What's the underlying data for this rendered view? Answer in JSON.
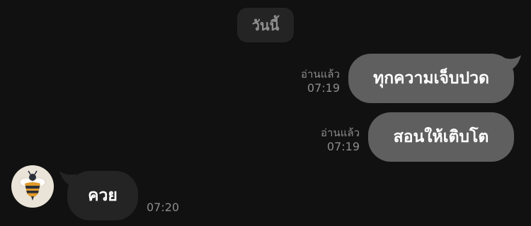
{
  "chat": {
    "date_label": "วันนี้",
    "messages": [
      {
        "direction": "outgoing",
        "text": "ทุกความเจ็บปวด",
        "read_label": "อ่านแล้ว",
        "time": "07:19"
      },
      {
        "direction": "outgoing",
        "text": "สอนให้เติบโต",
        "read_label": "อ่านแล้ว",
        "time": "07:19"
      },
      {
        "direction": "incoming",
        "text": "ควย",
        "time": "07:20"
      }
    ]
  },
  "colors": {
    "background": "#111111",
    "outgoing_bubble": "#5f5f5f",
    "incoming_bubble": "#242424",
    "meta_text": "#8c8c8c"
  },
  "icons": {
    "avatar": "bee-avatar-icon"
  }
}
